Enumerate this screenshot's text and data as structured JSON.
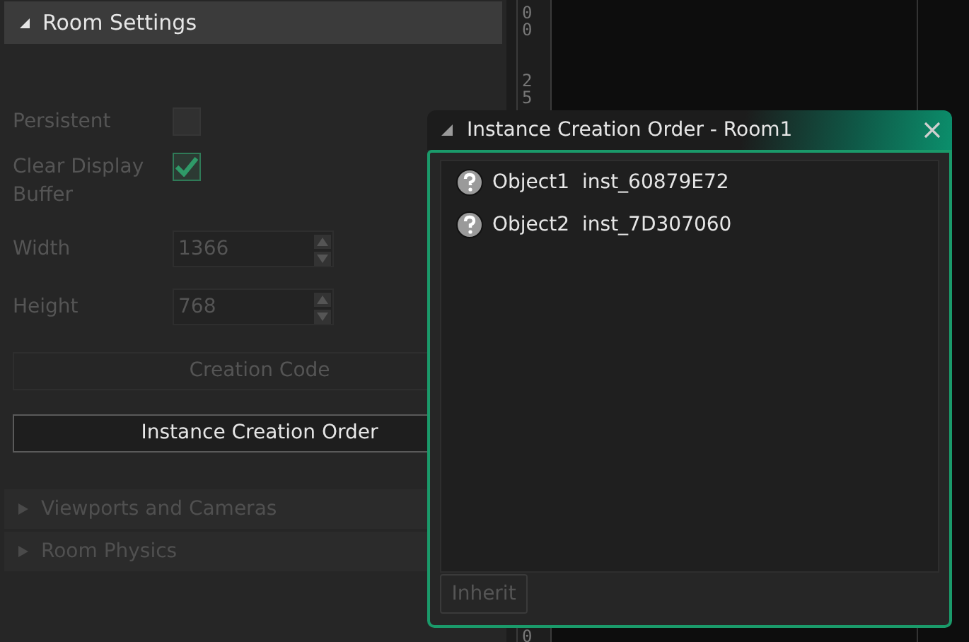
{
  "room_settings": {
    "title": "Room Settings",
    "expanded": true,
    "properties": [
      {
        "kind": "checkbox",
        "label": "Persistent",
        "checked": false
      },
      {
        "kind": "checkbox",
        "label": "Clear Display Buffer",
        "checked": true
      },
      {
        "kind": "number",
        "label": "Width",
        "value": "1366"
      },
      {
        "kind": "number",
        "label": "Height",
        "value": "768"
      }
    ],
    "buttons": [
      {
        "label": "Creation Code",
        "disabled": true
      },
      {
        "label": "Instance Creation Order",
        "disabled": false
      }
    ],
    "sections": [
      {
        "title": "Viewports and Cameras",
        "expanded": false
      },
      {
        "title": "Room Physics",
        "expanded": false
      }
    ]
  },
  "ruler": {
    "labels": [
      "00",
      "25",
      "0"
    ]
  },
  "dialog": {
    "title": "Instance Creation Order - Room1",
    "items": [
      {
        "object": "Object1",
        "instance": "inst_60879E72"
      },
      {
        "object": "Object2",
        "instance": "inst_7D307060"
      }
    ],
    "button": {
      "label": "Inherit",
      "disabled": true
    }
  }
}
